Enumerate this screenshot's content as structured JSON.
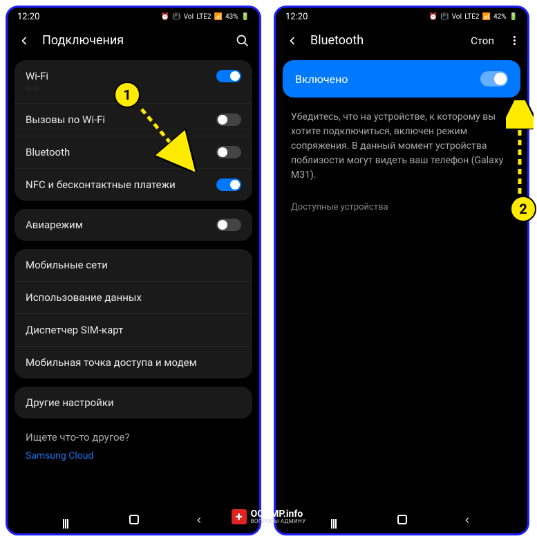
{
  "phone1": {
    "time": "12:20",
    "battery": "43%",
    "lte": "LTE2",
    "header_title": "Подключения",
    "wifi": {
      "label": "Wi-Fi",
      "network": "——"
    },
    "wifi_calling": "Вызовы по Wi-Fi",
    "bluetooth": "Bluetooth",
    "nfc": "NFC и бесконтактные платежи",
    "airplane": "Авиарежим",
    "mobile_networks": "Мобильные сети",
    "data_usage": "Использование данных",
    "sim_manager": "Диспетчер SIM-карт",
    "hotspot": "Мобильная точка доступа и модем",
    "other_settings": "Другие настройки",
    "search_prompt": "Ищете что-то другое?",
    "cloud_link": "Samsung Cloud"
  },
  "phone2": {
    "time": "12:20",
    "battery": "42%",
    "lte": "LTE2",
    "header_title": "Bluetooth",
    "stop": "Стоп",
    "enabled": "Включено",
    "info_text": "Убедитесь, что на устройстве, к которому вы хотите подключиться, включен режим сопряжения. В данный момент устройства поблизости могут видеть ваш телефон (Galaxy M31).",
    "available": "Доступные устройства"
  },
  "annotations": {
    "badge1": "1",
    "badge2": "2"
  },
  "watermark": {
    "main": "OCOMP.info",
    "sub": "ВОПРОСЫ АДМИНУ"
  }
}
